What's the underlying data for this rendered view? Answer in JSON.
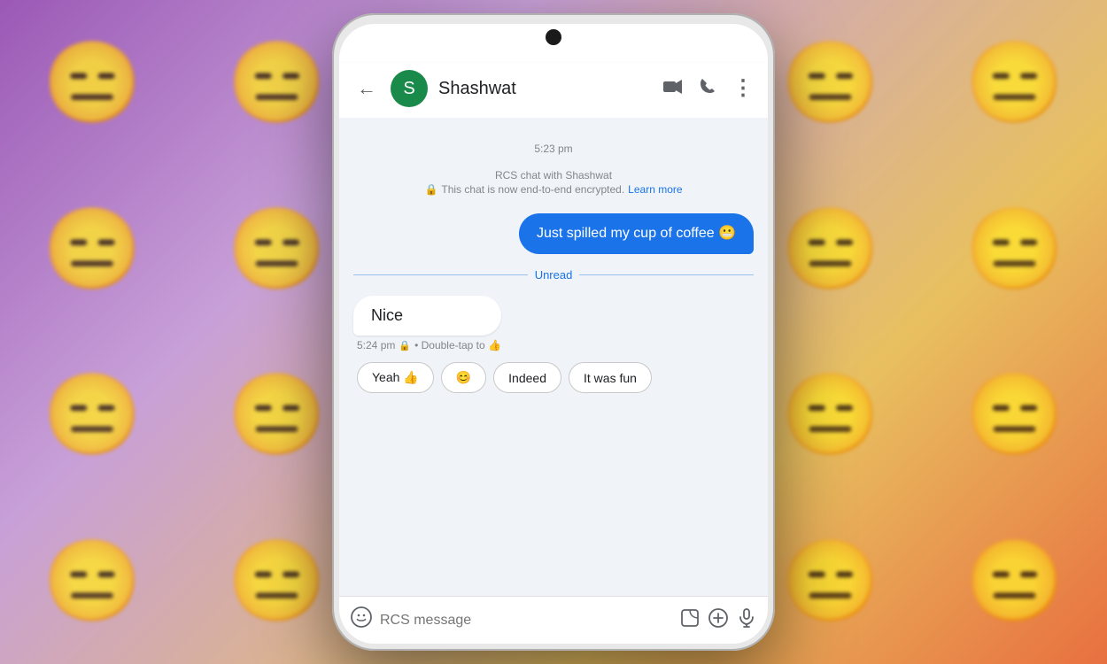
{
  "background": {
    "emoji": "😑"
  },
  "phone": {
    "header": {
      "back_label": "←",
      "avatar_initial": "S",
      "contact_name": "Shashwat",
      "video_icon": "📹",
      "phone_icon": "📞",
      "more_icon": "⋮"
    },
    "chat": {
      "timestamp": "5:23 pm",
      "rcs_title": "RCS chat with Shashwat",
      "encrypted_text": "This chat is now end-to-end encrypted.",
      "learn_more": "Learn more",
      "sent_message": "Just spilled my cup of coffee 😬",
      "unread_label": "Unread",
      "received_message": "Nice",
      "received_time": "5:24 pm",
      "lock_icon": "🔒",
      "double_tap_text": "• Double-tap to 👍"
    },
    "quick_replies": [
      {
        "label": "Yeah 👍"
      },
      {
        "label": "😊"
      },
      {
        "label": "Indeed"
      },
      {
        "label": "It was fun"
      }
    ],
    "input_bar": {
      "emoji_icon": "😊",
      "placeholder": "RCS message",
      "sticker_icon": "🖼",
      "add_icon": "⊕",
      "voice_icon": "🎤"
    }
  }
}
